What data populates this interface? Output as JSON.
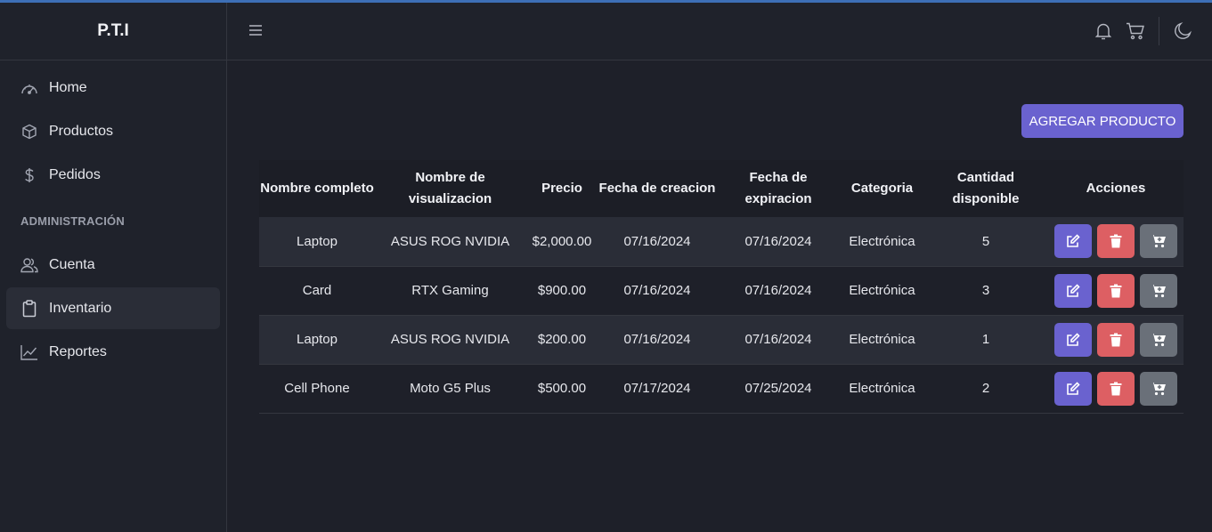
{
  "app": {
    "brand": "P.T.I"
  },
  "sidebar": {
    "items": [
      {
        "label": "Home",
        "icon": "speedometer-icon"
      },
      {
        "label": "Productos",
        "icon": "box-icon"
      },
      {
        "label": "Pedidos",
        "icon": "dollar-icon"
      }
    ],
    "section_label": "ADMINISTRACIÓN",
    "admin_items": [
      {
        "label": "Cuenta",
        "icon": "users-icon"
      },
      {
        "label": "Inventario",
        "icon": "clipboard-icon",
        "active": true
      },
      {
        "label": "Reportes",
        "icon": "chart-line-icon"
      }
    ]
  },
  "topbar": {
    "icons": [
      "menu-icon",
      "bell-icon",
      "cart-icon",
      "moon-icon"
    ]
  },
  "main": {
    "add_button": "AGREGAR PRODUCTO",
    "columns": [
      "Nombre completo",
      "Nombre de visualizacion",
      "Precio",
      "Fecha de creacion",
      "Fecha de expiracion",
      "Categoria",
      "Cantidad disponible",
      "Acciones"
    ],
    "rows": [
      [
        "Laptop",
        "ASUS ROG NVIDIA",
        "$2,000.00",
        "07/16/2024",
        "07/16/2024",
        "Electrónica",
        "5"
      ],
      [
        "Card",
        "RTX Gaming",
        "$900.00",
        "07/16/2024",
        "07/16/2024",
        "Electrónica",
        "3"
      ],
      [
        "Laptop",
        "ASUS ROG NVIDIA",
        "$200.00",
        "07/16/2024",
        "07/16/2024",
        "Electrónica",
        "1"
      ],
      [
        "Cell Phone",
        "Moto G5 Plus",
        "$500.00",
        "07/17/2024",
        "07/25/2024",
        "Electrónica",
        "2"
      ]
    ]
  },
  "colors": {
    "accent": "#6a62cf",
    "danger": "#dd5f63",
    "secondary": "#6a7079",
    "background": "#1e2029"
  }
}
